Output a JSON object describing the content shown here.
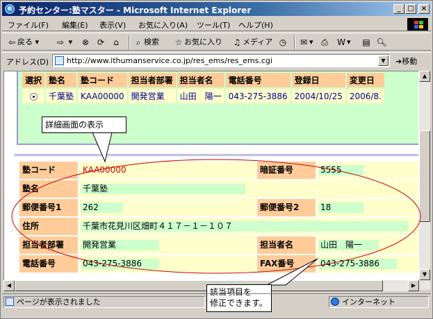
{
  "window": {
    "title": "予約センター:塾マスター - Microsoft Internet Explorer",
    "minimize": "_",
    "maximize": "□",
    "close": "×"
  },
  "menu": [
    "ファイル(F)",
    "編集(E)",
    "表示(V)",
    "お気に入り(A)",
    "ツール(T)",
    "ヘルプ(H)"
  ],
  "toolbar": {
    "back": "戻る",
    "search": "検索",
    "favorites": "お気に入り",
    "media": "メディア"
  },
  "address": {
    "label": "アドレス(D)",
    "url": "http://www.ithumanservice.co.jp/res_ems/res_ems.cgi",
    "go": "移動"
  },
  "list": {
    "headers": [
      "選択",
      "塾名",
      "塾コード",
      "担当者部署",
      "担当者名",
      "電話番号",
      "登録日",
      "変更日"
    ],
    "rows": [
      {
        "selected": true,
        "name": "千葉塾",
        "code": "KAA00000",
        "dept": "開発営業",
        "person": "山田　陽一",
        "phone": "043-275-3886",
        "registered": "2004/10/25",
        "changed": "2006/8."
      }
    ]
  },
  "detail": {
    "code_label": "塾コード",
    "code_value": "KAA00000",
    "pin_label": "暗証番号",
    "pin_value": "5555",
    "name_label": "塾名",
    "name_value": "千葉塾",
    "zip1_label": "郵便番号1",
    "zip1_value": "262",
    "zip2_label": "郵便番号2",
    "zip2_value": "18",
    "address_label": "住所",
    "address_value": "千葉市花見川区畑町４１７－１－１０７",
    "dept_label": "担当者部署",
    "dept_value": "開発営業",
    "person_label": "担当者名",
    "person_value": "山田　陽一",
    "phone_label": "電話番号",
    "phone_value": "043-275-3886",
    "fax_label": "FAX番号",
    "fax_value": "043-275-3886"
  },
  "annotations": {
    "detail_callout": "詳細画面の表示",
    "edit_callout_line1": "該当項目を",
    "edit_callout_line2": "修正できます。"
  },
  "status": {
    "message": "ページが表示されました",
    "zone": "インターネット"
  },
  "colors": {
    "header_cell": "#ffcc99",
    "value_cell": "#ffffcc",
    "list_bg": "#ccffcc",
    "code_text": "#cc0000",
    "ellipse": "#cc0000"
  }
}
